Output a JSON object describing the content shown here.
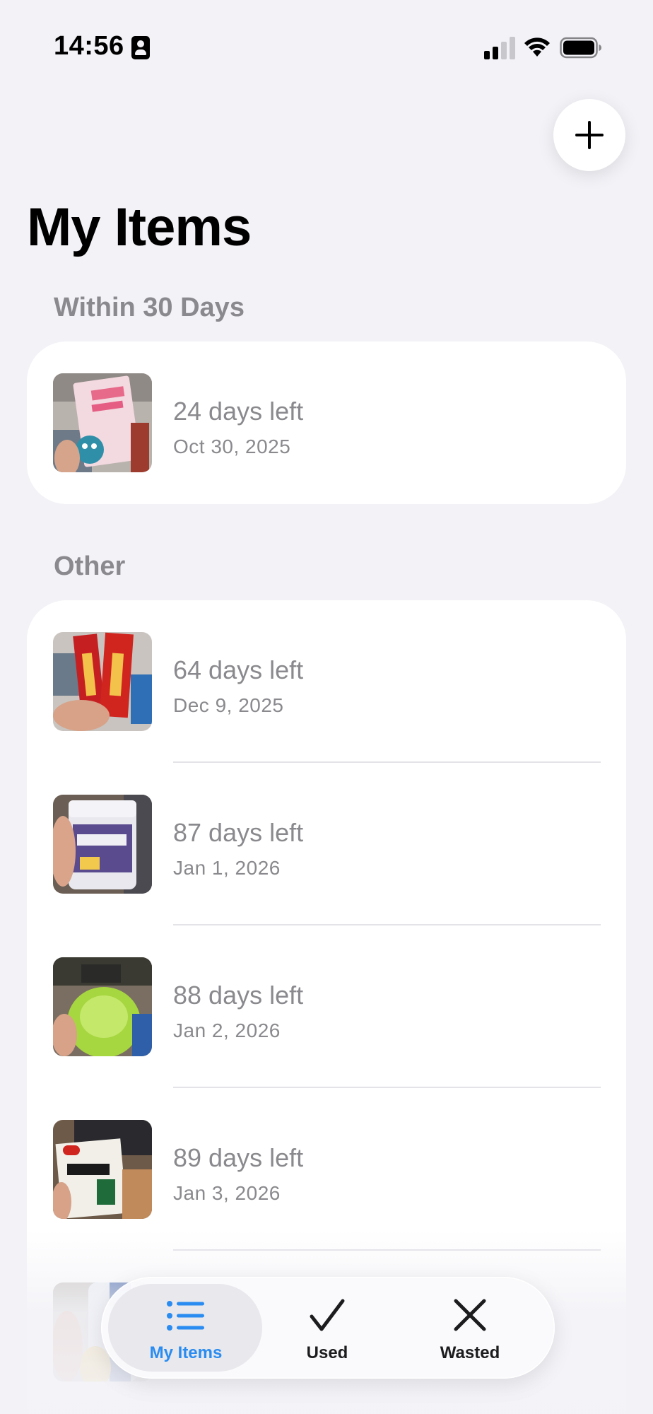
{
  "status_bar": {
    "time": "14:56"
  },
  "page": {
    "title": "My Items"
  },
  "sections": [
    {
      "header": "Within 30 Days",
      "items": [
        {
          "days_left": "24 days left",
          "date": "Oct 30, 2025"
        }
      ]
    },
    {
      "header": "Other",
      "items": [
        {
          "days_left": "64 days left",
          "date": "Dec 9, 2025"
        },
        {
          "days_left": "87 days left",
          "date": "Jan 1, 2026"
        },
        {
          "days_left": "88 days left",
          "date": "Jan 2, 2026"
        },
        {
          "days_left": "89 days left",
          "date": "Jan 3, 2026"
        }
      ]
    }
  ],
  "tab_bar": {
    "tabs": [
      {
        "label": "My Items",
        "icon": "list-icon",
        "active": true
      },
      {
        "label": "Used",
        "icon": "checkmark-icon",
        "active": false
      },
      {
        "label": "Wasted",
        "icon": "xmark-icon",
        "active": false
      }
    ]
  },
  "colors": {
    "accent": "#2a8cf0",
    "background": "#f2f2f7",
    "secondary_text": "#8a8a8e"
  }
}
